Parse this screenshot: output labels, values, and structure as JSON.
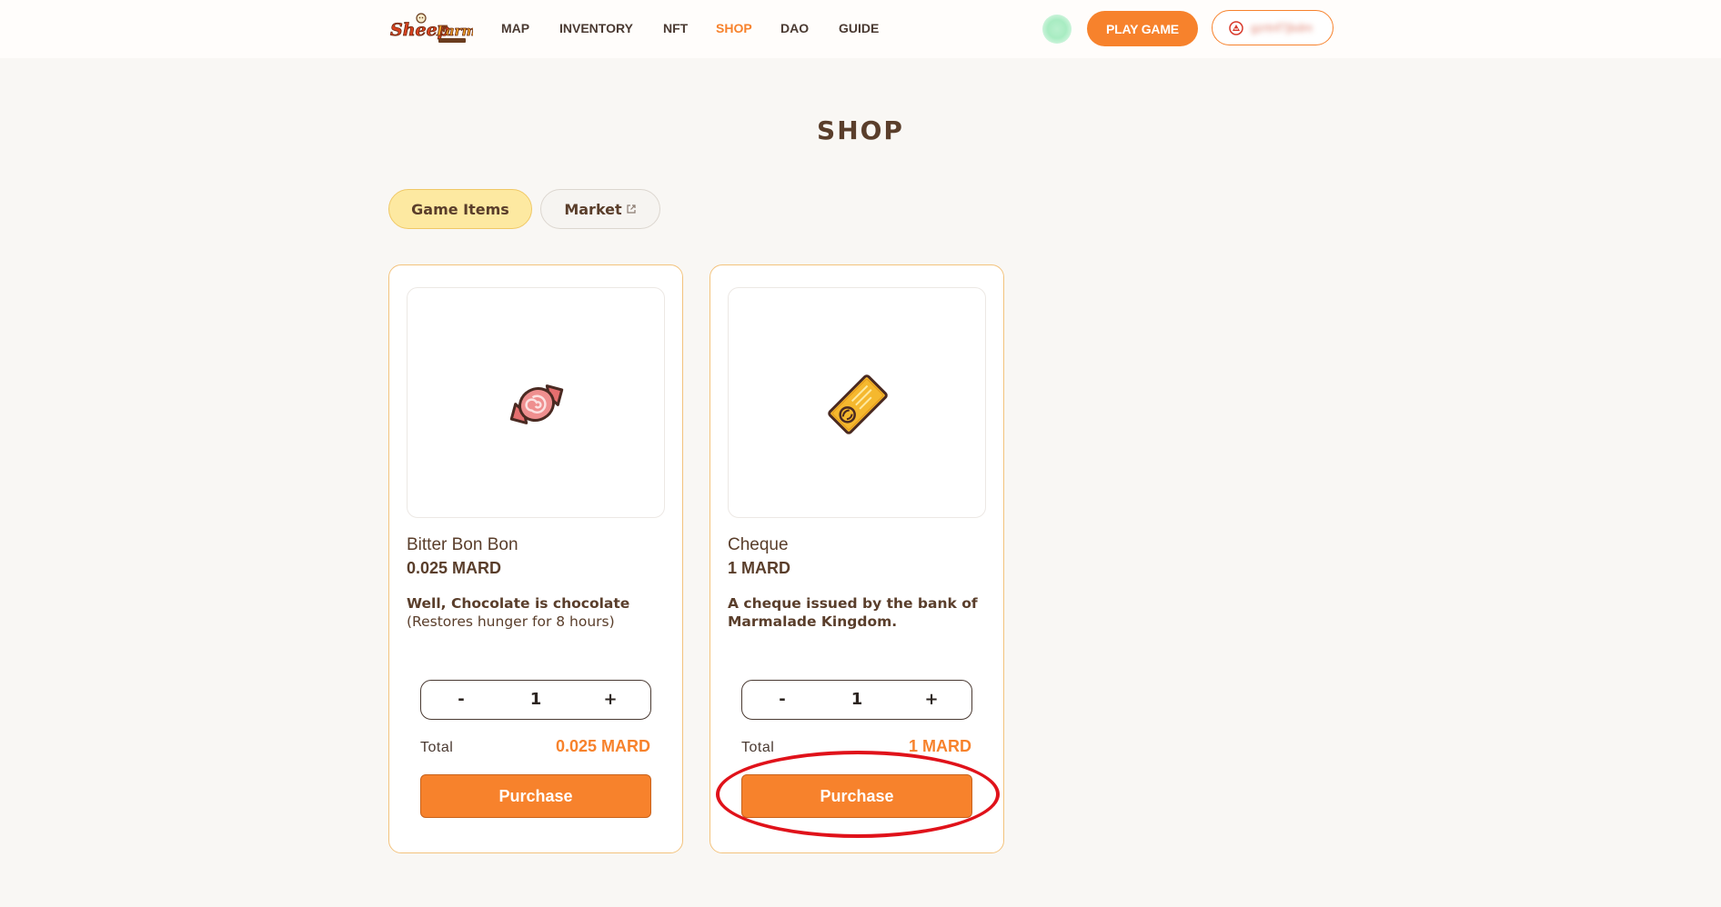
{
  "header": {
    "logo_text": "SheepFarm",
    "nav": [
      {
        "label": "MAP",
        "active": false
      },
      {
        "label": "INVENTORY",
        "active": false
      },
      {
        "label": "NFT",
        "active": false
      },
      {
        "label": "SHOP",
        "active": true
      },
      {
        "label": "DAO",
        "active": false
      },
      {
        "label": "GUIDE",
        "active": false
      }
    ],
    "play_label": "PLAY GAME",
    "wallet_address": "gzrtnf7jbdm"
  },
  "page_title": "SHOP",
  "tabs": [
    {
      "label": "Game Items",
      "active": true
    },
    {
      "label": "Market",
      "external_icon": "external-link-icon"
    }
  ],
  "items": [
    {
      "icon": "candy-icon",
      "name": "Bitter Bon Bon",
      "price": "0.025 MARD",
      "description": "Well, Chocolate is chocolate",
      "effect": "(Restores hunger for 8 hours)",
      "quantity": "1",
      "minus_label": "-",
      "plus_label": "+",
      "total_label": "Total",
      "total_value": "0.025 MARD",
      "purchase_label": "Purchase"
    },
    {
      "icon": "cheque-icon",
      "name": "Cheque",
      "price": "1 MARD",
      "description": "A cheque issued by the bank of Marmalade Kingdom.",
      "effect": "",
      "quantity": "1",
      "minus_label": "-",
      "plus_label": "+",
      "total_label": "Total",
      "total_value": "1 MARD",
      "purchase_label": "Purchase"
    }
  ],
  "colors": {
    "accent": "#f7822c",
    "highlight_ring": "#e0121a",
    "tab_active_bg": "#fde9a1"
  }
}
